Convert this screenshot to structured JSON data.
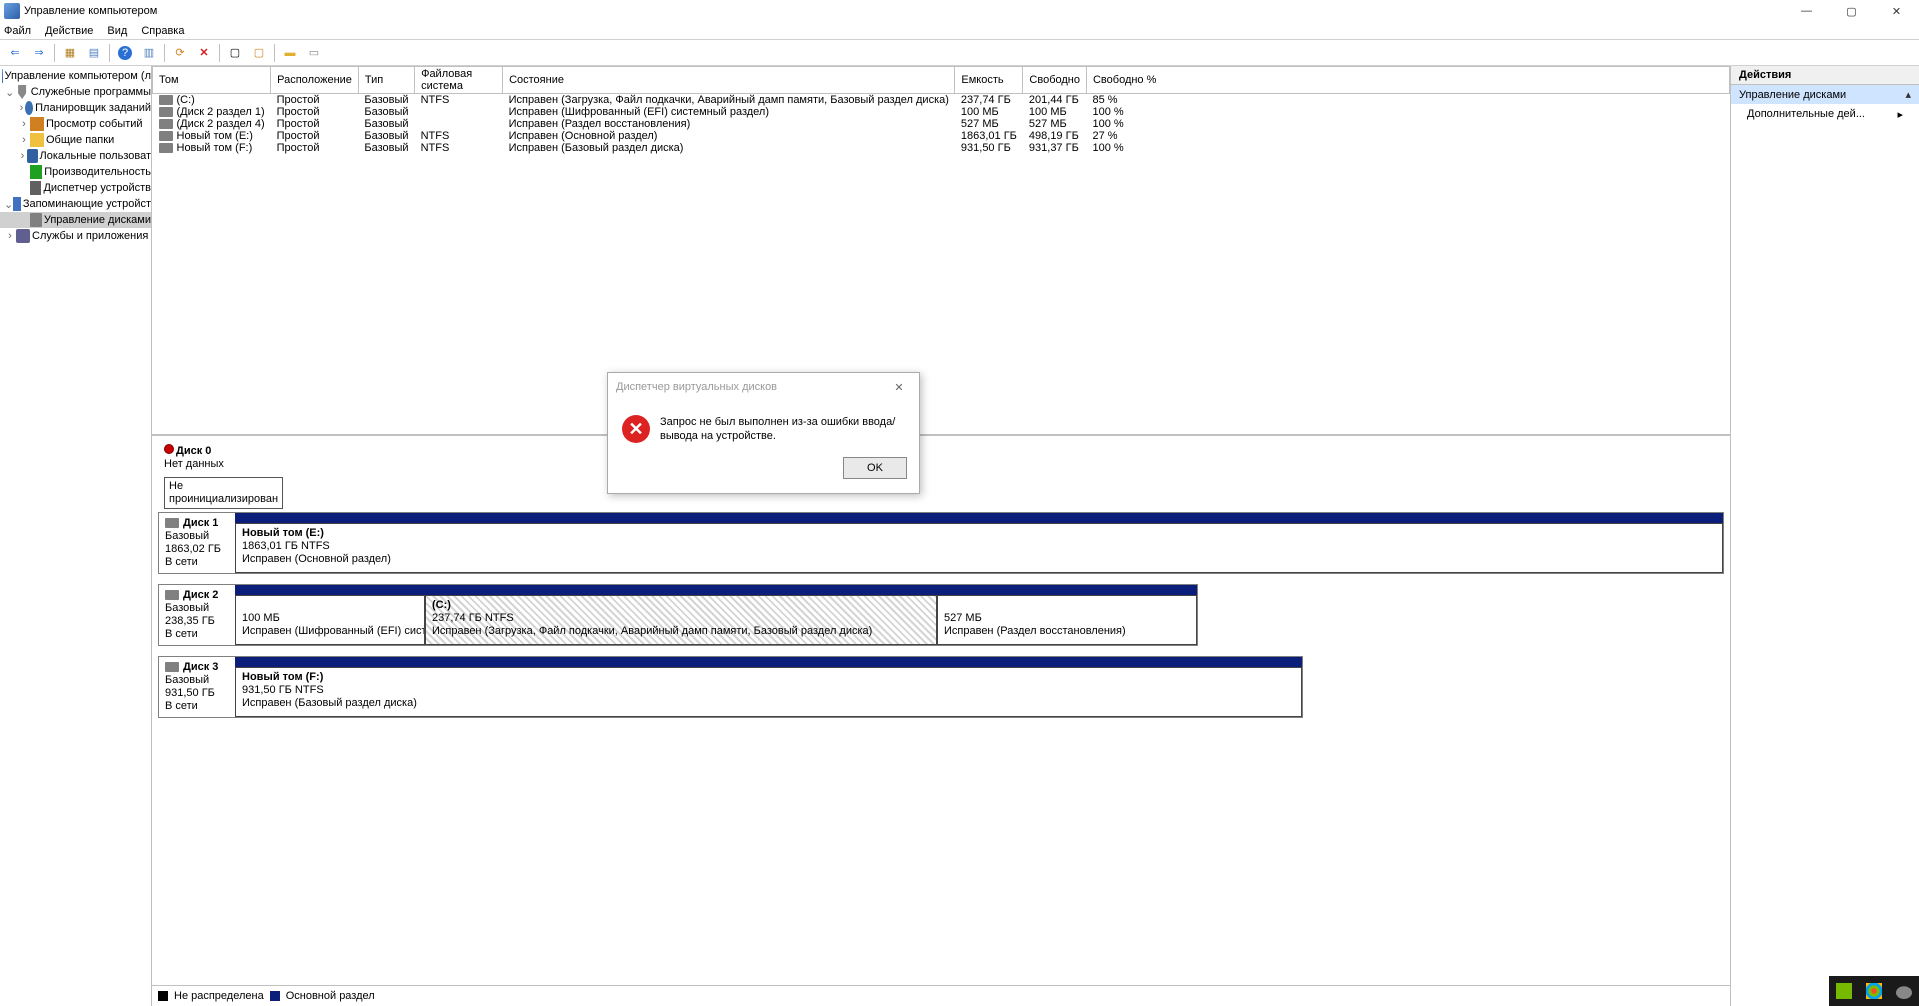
{
  "window": {
    "title": "Управление компьютером",
    "btn_min": "—",
    "btn_max": "▢",
    "btn_close": "✕"
  },
  "menubar": {
    "file": "Файл",
    "action": "Действие",
    "view": "Вид",
    "help": "Справка"
  },
  "tree": {
    "root": "Управление компьютером (л",
    "sys_tools": "Служебные программы",
    "scheduler": "Планировщик заданий",
    "events": "Просмотр событий",
    "shares": "Общие папки",
    "users": "Локальные пользоват",
    "perf": "Производительность",
    "devmgr": "Диспетчер устройств",
    "storage": "Запоминающие устройст",
    "diskmgmt": "Управление дисками",
    "services": "Службы и приложения"
  },
  "columns": {
    "volume": "Том",
    "layout": "Расположение",
    "type": "Тип",
    "fs": "Файловая система",
    "status": "Состояние",
    "capacity": "Емкость",
    "free": "Свободно",
    "freepct": "Свободно %"
  },
  "volumes": [
    {
      "name": "(C:)",
      "layout": "Простой",
      "type": "Базовый",
      "fs": "NTFS",
      "status": "Исправен (Загрузка, Файл подкачки, Аварийный дамп памяти, Базовый раздел диска)",
      "cap": "237,74 ГБ",
      "free": "201,44 ГБ",
      "pct": "85 %"
    },
    {
      "name": "(Диск 2 раздел 1)",
      "layout": "Простой",
      "type": "Базовый",
      "fs": "",
      "status": "Исправен (Шифрованный (EFI) системный раздел)",
      "cap": "100 МБ",
      "free": "100 МБ",
      "pct": "100 %"
    },
    {
      "name": "(Диск 2 раздел 4)",
      "layout": "Простой",
      "type": "Базовый",
      "fs": "",
      "status": "Исправен (Раздел восстановления)",
      "cap": "527 МБ",
      "free": "527 МБ",
      "pct": "100 %"
    },
    {
      "name": "Новый том (E:)",
      "layout": "Простой",
      "type": "Базовый",
      "fs": "NTFS",
      "status": "Исправен (Основной раздел)",
      "cap": "1863,01 ГБ",
      "free": "498,19 ГБ",
      "pct": "27 %"
    },
    {
      "name": "Новый том (F:)",
      "layout": "Простой",
      "type": "Базовый",
      "fs": "NTFS",
      "status": "Исправен (Базовый раздел диска)",
      "cap": "931,50 ГБ",
      "free": "931,37 ГБ",
      "pct": "100 %"
    }
  ],
  "disk0": {
    "name": "Диск 0",
    "nodata": "Нет данных",
    "uninit": "Не проинициализирован"
  },
  "disk1": {
    "name": "Диск 1",
    "type": "Базовый",
    "size": "1863,02 ГБ",
    "state": "В сети",
    "p1name": "Новый том  (E:)",
    "p1size": "1863,01 ГБ NTFS",
    "p1status": "Исправен (Основной раздел)"
  },
  "disk2": {
    "name": "Диск 2",
    "type": "Базовый",
    "size": "238,35 ГБ",
    "state": "В сети",
    "p1size": "100 МБ",
    "p1status": "Исправен (Шифрованный (EFI) системнь",
    "p2name": "(C:)",
    "p2size": "237,74 ГБ NTFS",
    "p2status": "Исправен (Загрузка, Файл подкачки, Аварийный дамп памяти, Базовый раздел диска)",
    "p3size": "527 МБ",
    "p3status": "Исправен (Раздел восстановления)"
  },
  "disk3": {
    "name": "Диск 3",
    "type": "Базовый",
    "size": "931,50 ГБ",
    "state": "В сети",
    "p1name": "Новый том  (F:)",
    "p1size": "931,50 ГБ NTFS",
    "p1status": "Исправен (Базовый раздел диска)"
  },
  "legend": {
    "unalloc": "Не распределена",
    "primary": "Основной раздел"
  },
  "actions": {
    "header": "Действия",
    "title": "Управление дисками",
    "more": "Дополнительные дей..."
  },
  "dialog": {
    "title": "Диспетчер виртуальных дисков",
    "message": "Запрос не был выполнен из-за ошибки ввода/вывода на устройстве.",
    "ok": "OK",
    "close": "✕"
  }
}
